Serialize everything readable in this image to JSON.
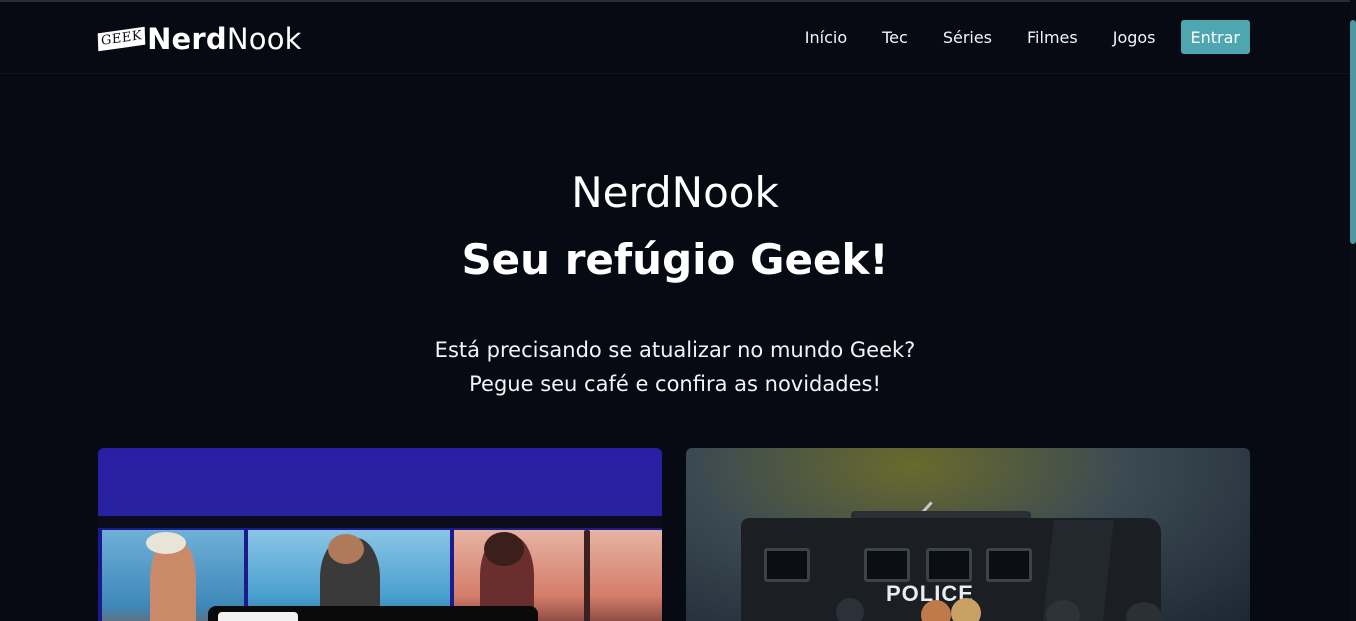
{
  "brand": {
    "badge": "GEEK",
    "name_bold": "Nerd",
    "name_light": "Nook"
  },
  "nav": {
    "links": [
      "Início",
      "Tec",
      "Séries",
      "Filmes",
      "Jogos"
    ],
    "cta": "Entrar"
  },
  "hero": {
    "title": "NerdNook",
    "subtitle": "Seu refúgio Geek!",
    "line1": "Está precisando se atualizar no mundo Geek?",
    "line2": "Pegue seu café e confira as novidades!"
  },
  "cards": {
    "right_sign": "POLICE"
  },
  "colors": {
    "background": "#070a12",
    "accent": "#4ea6b0",
    "text": "#ffffff"
  }
}
